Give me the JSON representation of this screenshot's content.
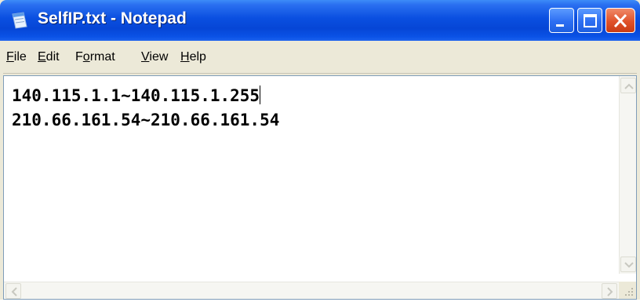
{
  "window": {
    "title": "SelfIP.txt - Notepad"
  },
  "menu": {
    "items": [
      {
        "id": "file",
        "accel": "F",
        "rest": "ile"
      },
      {
        "id": "edit",
        "accel": "E",
        "rest": "dit"
      },
      {
        "id": "format",
        "pre": "F",
        "accel": "o",
        "rest": "rmat"
      },
      {
        "id": "view",
        "accel": "V",
        "rest": "iew"
      },
      {
        "id": "help",
        "accel": "H",
        "rest": "elp"
      }
    ]
  },
  "document": {
    "lines": [
      "140.115.1.1~140.115.1.255",
      "210.66.161.54~210.66.161.54"
    ]
  },
  "colors": {
    "titlebar": "#0a4fe0",
    "close_button": "#e0522a",
    "chrome": "#ece9d8"
  },
  "icons": {
    "app": "notepad-icon",
    "minimize": "minimize-icon",
    "maximize": "maximize-icon",
    "close": "close-icon"
  }
}
